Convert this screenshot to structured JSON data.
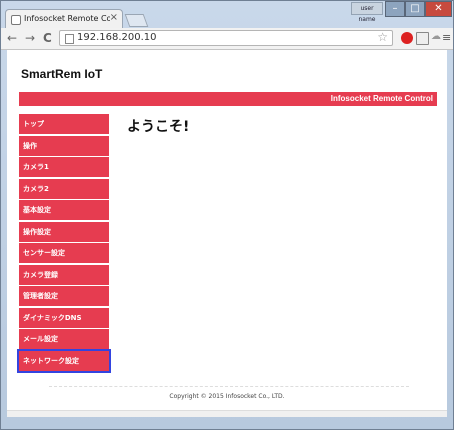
{
  "browser": {
    "tab_title": "Infosocket Remote Con",
    "tab_close": "×",
    "user_name": "user name",
    "window_controls": {
      "minimize": "–",
      "maximize": "□",
      "close": "✕"
    },
    "url": "192.168.200.10",
    "nav": {
      "back": "←",
      "forward": "→",
      "reload": "C"
    },
    "icons": [
      "page-icon",
      "bookmark-star-icon",
      "red-extension-icon",
      "download-extension-icon",
      "cloud-extension-icon",
      "menu-icon"
    ]
  },
  "page": {
    "site_title": "SmartRem IoT",
    "banner_text": "Infosocket Remote Control",
    "welcome": "ようこそ!",
    "footer": "Copyright © 2015 Infosocket Co., LTD."
  },
  "sidebar": {
    "items": [
      {
        "label": "トップ"
      },
      {
        "label": "操作"
      },
      {
        "label": "カメラ1"
      },
      {
        "label": "カメラ2"
      },
      {
        "label": "基本設定"
      },
      {
        "label": "操作設定"
      },
      {
        "label": "センサー設定"
      },
      {
        "label": "カメラ登録"
      },
      {
        "label": "管理者設定"
      },
      {
        "label": "ダイナミックDNS"
      },
      {
        "label": "メール設定"
      },
      {
        "label": "ネットワーク設定"
      }
    ],
    "selected_index": 11
  },
  "colors": {
    "accent": "#e63c50",
    "selection_outline": "#3344e0"
  }
}
